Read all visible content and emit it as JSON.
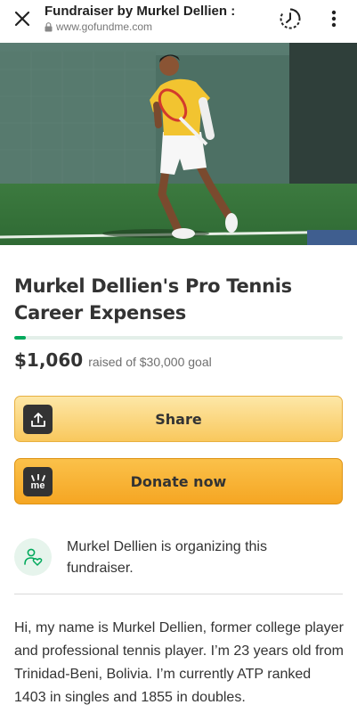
{
  "browser": {
    "title": "Fundraiser by Murkel Dellien :",
    "url": "www.gofundme.com",
    "icons": {
      "close": "close-icon",
      "lock": "lock-icon",
      "history": "history-icon",
      "menu": "more-vert-icon"
    }
  },
  "hero": {
    "alt": "tennis-player-photo"
  },
  "campaign": {
    "title": "Murkel Dellien's Pro Tennis Career Expenses",
    "raised": "$1,060",
    "goal_text": "raised of $30,000 goal",
    "progress_fraction": 0.035
  },
  "buttons": {
    "share_label": "Share",
    "donate_label": "Donate now",
    "share_icon": "share-upload-icon",
    "donate_icon": "gofundme-me-icon",
    "me_text": "me"
  },
  "organizer": {
    "text": "Murkel Dellien is organizing this fundraiser.",
    "icon": "organizer-heart-icon"
  },
  "story": {
    "text": "Hi, my name is Murkel Dellien, former college player and professional tennis player. I’m 23 years old from Trinidad-Beni, Bolivia. I’m currently ATP ranked 1403 in singles and 1855 in doubles."
  },
  "colors": {
    "accent_green": "#02a95c",
    "share_button": "#f9c85d",
    "donate_button": "#f5a623",
    "text": "#333333"
  }
}
